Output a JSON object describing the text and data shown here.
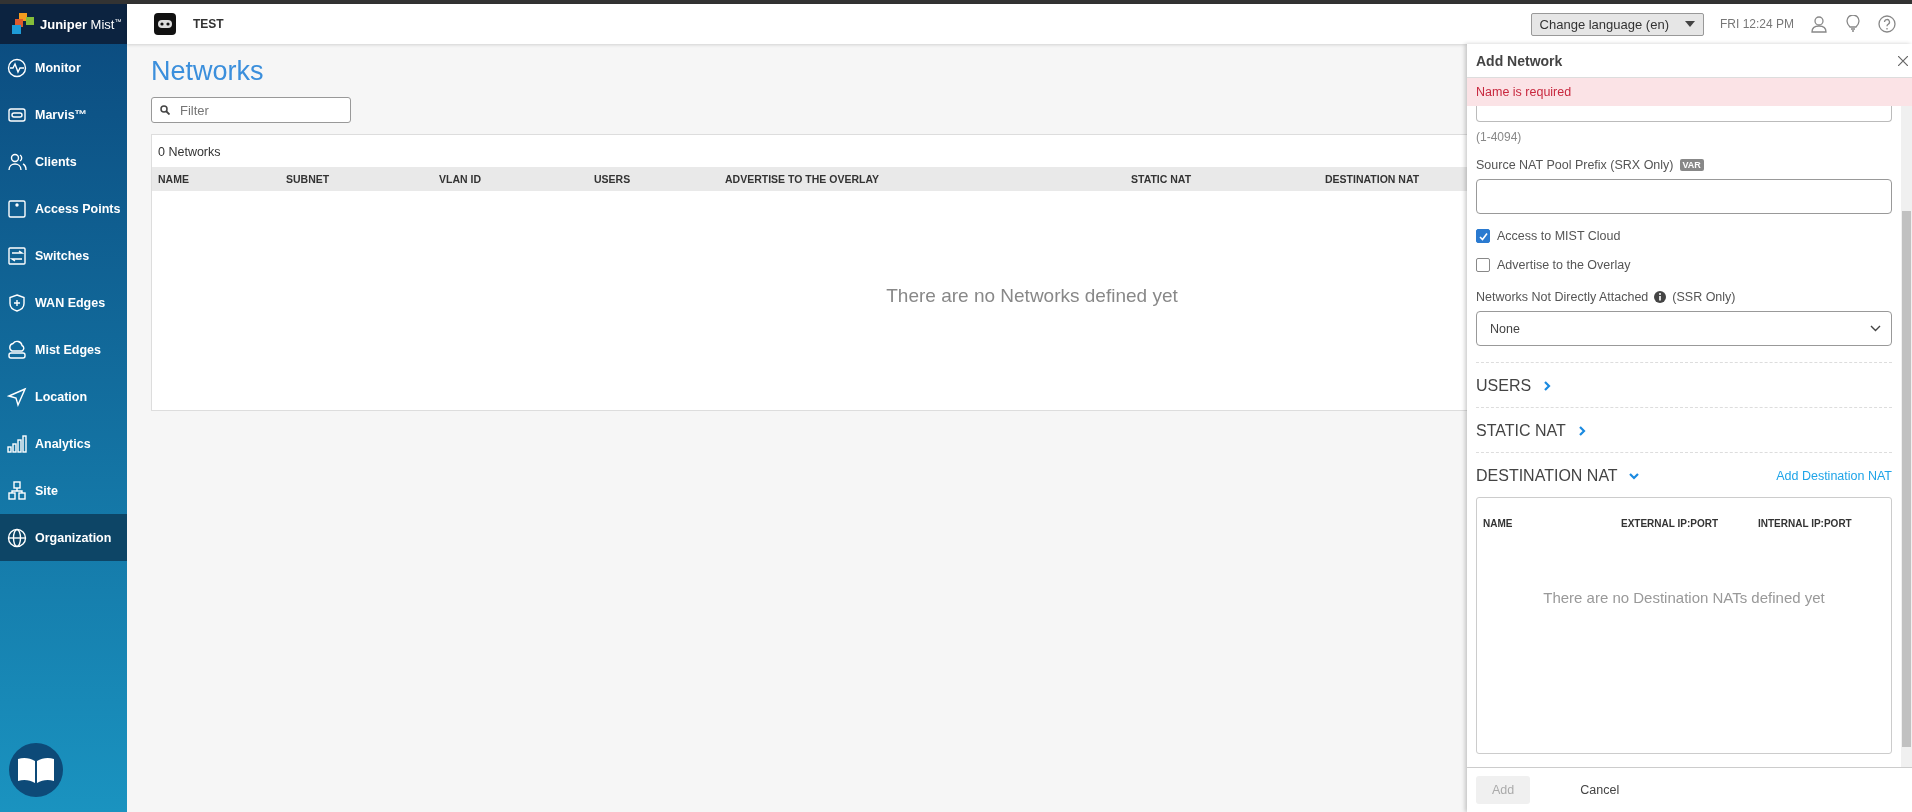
{
  "sidebar": {
    "logo": "**Juniper** Mist$^{™}$",
    "items": [
      {
        "label": "Monitor",
        "selected": false
      },
      {
        "label": "Marvis™",
        "selected": false
      },
      {
        "label": "Clients",
        "selected": false
      },
      {
        "label": "Access Points",
        "selected": false
      },
      {
        "label": "Switches",
        "selected": false
      },
      {
        "label": "WAN Edges",
        "selected": false
      },
      {
        "label": "Mist Edges",
        "selected": false
      },
      {
        "label": "Location",
        "selected": false
      },
      {
        "label": "Analytics",
        "selected": false
      },
      {
        "label": "Site",
        "selected": false
      },
      {
        "label": "Organization",
        "selected": true
      }
    ]
  },
  "header": {
    "org": "TEST",
    "language": "Change language (en)",
    "time": "FRI 12:24 PM"
  },
  "page": {
    "title": "Networks",
    "filter": {
      "placeholder": "Filter"
    },
    "count": "0 Networks",
    "columns": [
      "NAME",
      "SUBNET",
      "VLAN ID",
      "USERS",
      "ADVERTISE TO THE OVERLAY",
      "STATIC NAT",
      "DESTINATION NAT"
    ],
    "empty": "There are no Networks defined yet"
  },
  "panel": {
    "title": "Add Network",
    "error": "Name is required",
    "vlan_hint": "(1-4094)",
    "source_nat": {
      "label": "Source NAT Pool Prefix (SRX Only)",
      "badge": "VAR"
    },
    "checkboxes": [
      {
        "label": "Access to MIST Cloud",
        "checked": true
      },
      {
        "label": "Advertise to the Overlay",
        "checked": false
      }
    ],
    "networks": {
      "label": "Networks Not Directly Attached",
      "note": "(SSR Only)",
      "value": "None"
    },
    "sections": [
      {
        "title": "USERS",
        "expanded": false
      },
      {
        "title": "STATIC NAT",
        "expanded": false
      },
      {
        "title": "DESTINATION NAT",
        "expanded": true,
        "action": "Add Destination NAT",
        "columns": [
          "NAME",
          "EXTERNAL IP:PORT",
          "INTERNAL IP:PORT"
        ],
        "empty": "There are no Destination NATs defined yet"
      }
    ],
    "buttons": [
      {
        "label": "Add",
        "kind": "primary",
        "disabled": true
      },
      {
        "label": "Cancel",
        "kind": "link",
        "disabled": false
      }
    ]
  }
}
